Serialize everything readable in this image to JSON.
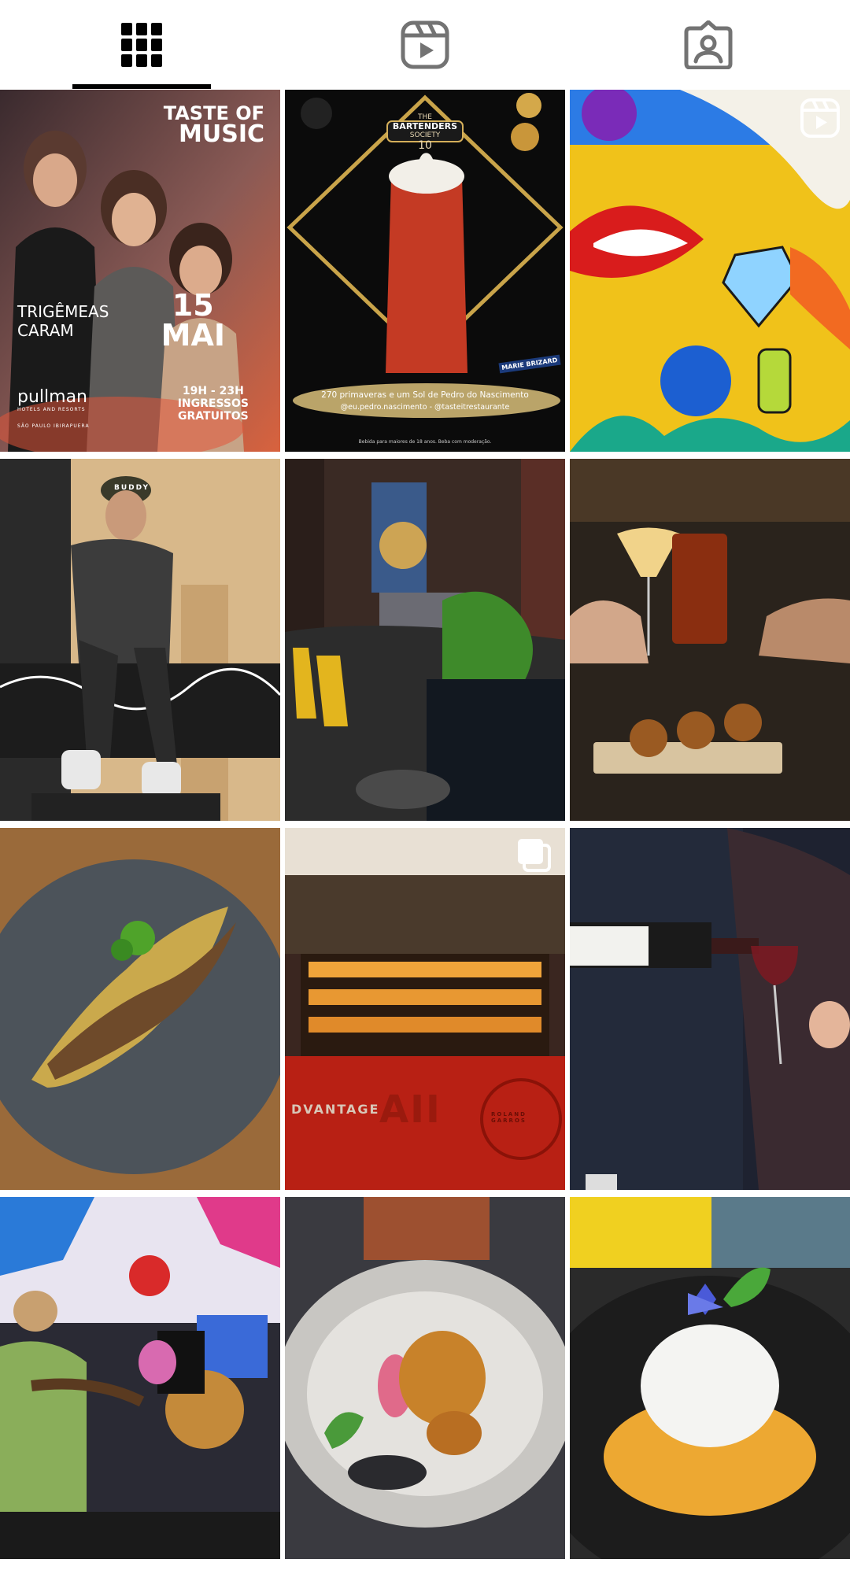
{
  "tabs": [
    {
      "name": "posts",
      "icon": "grid-icon",
      "active": true
    },
    {
      "name": "reels",
      "icon": "reels-icon",
      "active": false
    },
    {
      "name": "tagged",
      "icon": "tagged-person-icon",
      "active": false
    }
  ],
  "colors": {
    "active_icon": "#000000",
    "inactive_icon": "#737373",
    "background": "#ffffff"
  },
  "posts": {
    "p1": {
      "type": "image",
      "headline_line1": "TASTE OF",
      "headline_line2": "MUSIC",
      "artist_line1": "TRIGÊMEAS",
      "artist_line2": "CARAM",
      "day": "15",
      "month": "MAI",
      "brand": "pullman",
      "brand_sub": "HOTELS AND RESORTS",
      "brand_location": "SÃO PAULO IBIRAPUERA",
      "time": "19H - 23H",
      "entry_line1": "INGRESSOS",
      "entry_line2": "GRATUITOS"
    },
    "p2": {
      "type": "image",
      "badge_top": "THE",
      "badge_main": "BARTENDERS",
      "badge_sub": "SOCIETY",
      "badge_number": "10",
      "sponsor": "MARIE BRIZARD",
      "caption": "270 primaveras e um Sol de Pedro do Nascimento",
      "handles": "@eu.pedro.nascimento - @tasteitrestaurante",
      "disclaimer": "Bebida para maiores de 18 anos. Beba com moderação."
    },
    "p3": {
      "type": "reel",
      "overlay_icon": "reels-icon"
    },
    "p4": {
      "type": "image",
      "cap_text": "BUDDY"
    },
    "p5": {
      "type": "image"
    },
    "p6": {
      "type": "image"
    },
    "p7": {
      "type": "image"
    },
    "p8": {
      "type": "carousel",
      "overlay_icon": "carousel-icon",
      "sign_left": "DVANTAGE",
      "sign_mid": "AII",
      "sign_logo": "ROLAND GARROS"
    },
    "p9": {
      "type": "image"
    },
    "p10": {
      "type": "image"
    },
    "p11": {
      "type": "image"
    },
    "p12": {
      "type": "image"
    }
  }
}
